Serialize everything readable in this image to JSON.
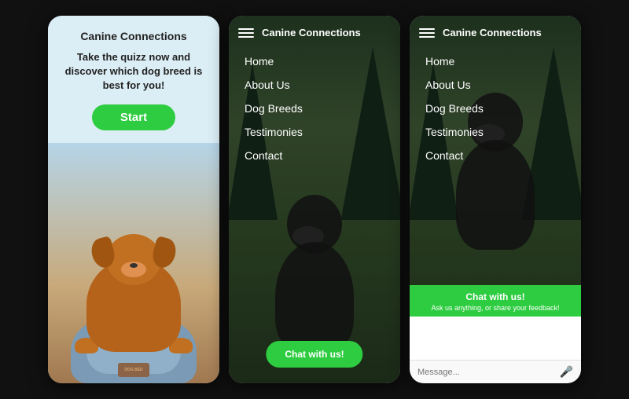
{
  "screen1": {
    "title": "Canine Connections",
    "tagline": "Take the quizz now and discover which dog breed is best for you!",
    "start_button": "Start"
  },
  "screen2": {
    "title": "Canine Connections",
    "nav_items": [
      "Home",
      "About Us",
      "Dog Breeds",
      "Testimonies",
      "Contact"
    ],
    "chat_button": "Chat with us!"
  },
  "screen3": {
    "title": "Canine Connections",
    "nav_items": [
      "Home",
      "About Us",
      "Dog Breeds",
      "Testimonies",
      "Contact"
    ],
    "chat_header_title": "Chat with us!",
    "chat_header_sub": "Ask us anything, or share your feedback!",
    "chat_placeholder": "Message..."
  }
}
